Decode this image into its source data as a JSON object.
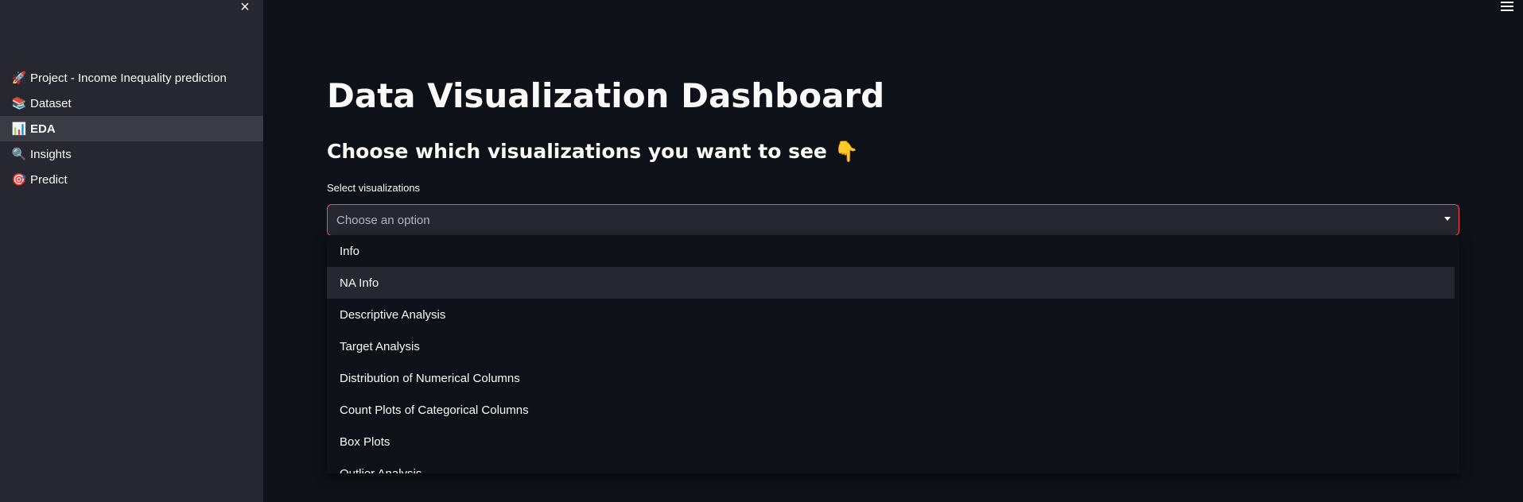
{
  "sidebar": {
    "close_icon": "×",
    "items": [
      {
        "icon": "🚀",
        "icon_name": "rocket-icon",
        "label": "Project - Income Inequality prediction",
        "active": false
      },
      {
        "icon": "📚",
        "icon_name": "books-icon",
        "label": "Dataset",
        "active": false
      },
      {
        "icon": "📊",
        "icon_name": "bar-chart-icon",
        "label": "EDA",
        "active": true
      },
      {
        "icon": "🔍",
        "icon_name": "magnifier-icon",
        "label": "Insights",
        "active": false
      },
      {
        "icon": "🎯",
        "icon_name": "target-icon",
        "label": "Predict",
        "active": false
      }
    ]
  },
  "main": {
    "title": "Data Visualization Dashboard",
    "subtitle": "Choose which visualizations you want to see 👇",
    "select": {
      "label": "Select visualizations",
      "placeholder": "Choose an option",
      "options": [
        "Info",
        "NA Info",
        "Descriptive Analysis",
        "Target Analysis",
        "Distribution of Numerical Columns",
        "Count Plots of Categorical Columns",
        "Box Plots",
        "Outlier Analysis"
      ],
      "highlighted_index": 1
    }
  },
  "colors": {
    "background": "#0e1117",
    "sidebar": "#262730",
    "active_item": "#3a3b45",
    "focus_border": "#ff4b4b",
    "text": "#fafafa"
  }
}
